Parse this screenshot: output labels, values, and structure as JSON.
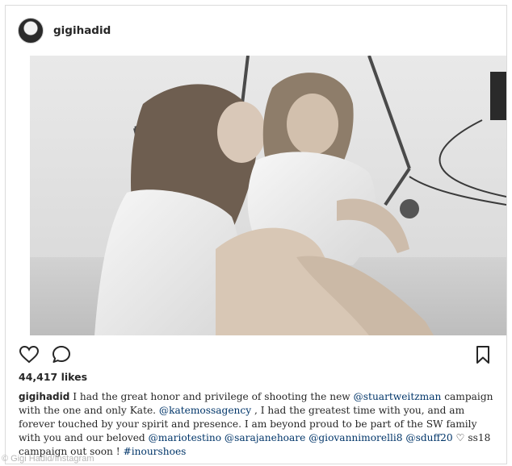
{
  "post": {
    "username": "gigihadid",
    "photo_alt": "black and white photo",
    "likes": "44,417 likes",
    "caption": {
      "username": "gigihadid",
      "parts": [
        {
          "type": "text",
          "text": " I had the great honor and privilege of shooting the new "
        },
        {
          "type": "mention",
          "text": "@stuartweitzman"
        },
        {
          "type": "text",
          "text": " campaign with the one and only Kate. "
        },
        {
          "type": "mention",
          "text": "@katemossagency"
        },
        {
          "type": "text",
          "text": " , I had the greatest time with you, and am forever touched by your spirit and presence. I am beyond proud to be part of the SW family with you and our beloved "
        },
        {
          "type": "mention",
          "text": "@mariotestino"
        },
        {
          "type": "text",
          "text": " "
        },
        {
          "type": "mention",
          "text": "@sarajanehoare"
        },
        {
          "type": "text",
          "text": " "
        },
        {
          "type": "mention",
          "text": "@giovannimorelli8"
        },
        {
          "type": "text",
          "text": " "
        },
        {
          "type": "mention",
          "text": "@sduff20"
        },
        {
          "type": "text",
          "text": " ♡ ss18 campaign out soon ! "
        },
        {
          "type": "hashtag",
          "text": "#inourshoes"
        }
      ]
    },
    "icons": {
      "like": "heart-icon",
      "comment": "comment-icon",
      "save": "bookmark-icon"
    }
  },
  "watermark": "© Gigi Hadid/Instagram",
  "colors": {
    "text": "#262626",
    "link": "#003569",
    "border": "#dbdbdb"
  }
}
